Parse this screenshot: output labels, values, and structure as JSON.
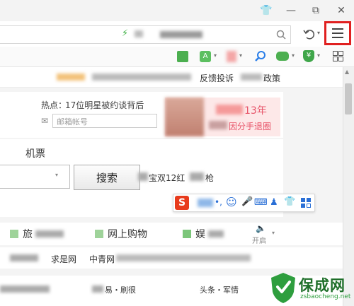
{
  "window_controls": {
    "skin": "👕",
    "minimize": "—",
    "restore": "⧉",
    "close": "✕"
  },
  "address_bar": {
    "url": "",
    "go_icon": "⚡"
  },
  "menu_button": {
    "label": "≡"
  },
  "page_nav": {
    "items": [
      "反馈投诉",
      "政策"
    ]
  },
  "hot": {
    "label": "热点：",
    "text": "17位明星被约谈背后"
  },
  "mail": {
    "placeholder": "邮箱帐号"
  },
  "ad": {
    "title": "13年",
    "subtitle": "因分手退圈"
  },
  "search_tabs": {
    "active": "机票"
  },
  "search": {
    "button": "搜索",
    "suggestion": "宝双12红",
    "suggestion_tail": "枪"
  },
  "ime": {
    "logo": "S"
  },
  "quick_tiles": [
    "旅",
    "网上购物",
    "娱"
  ],
  "sound": {
    "label": "开启"
  },
  "links_row": [
    "求是网",
    "中青网"
  ],
  "news_row": [
    "易・刷很",
    "头条・军情"
  ],
  "watermark": {
    "text": "保成网",
    "url": "zsbaocheng.net"
  },
  "colors": {
    "highlight": "#e02020",
    "ime_logo": "#e83b1c",
    "watermark_green": "#2e9e3e"
  }
}
